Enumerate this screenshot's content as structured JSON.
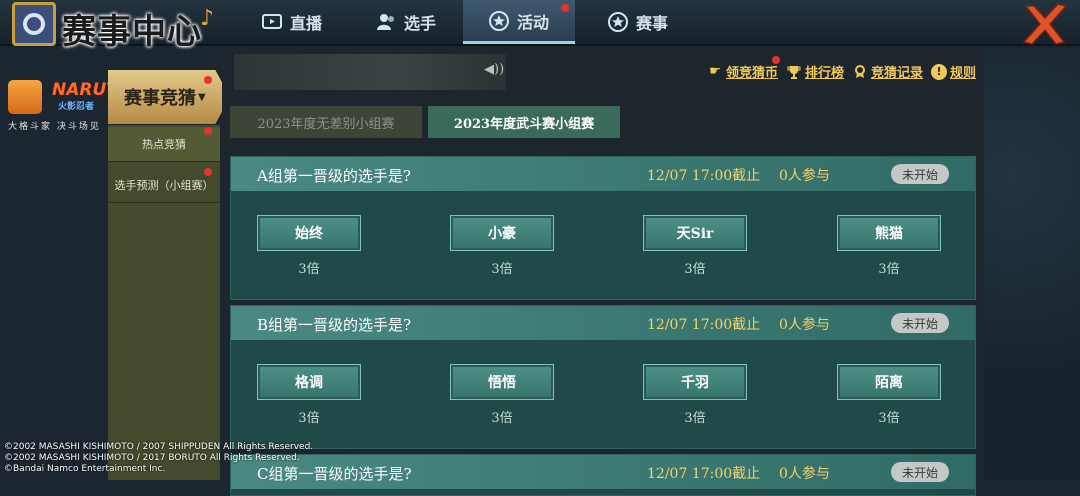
{
  "header": {
    "title": "赛事中心",
    "nav_tabs": [
      {
        "label": "直播",
        "icon": "tv-icon",
        "active": false,
        "dot": false
      },
      {
        "label": "选手",
        "icon": "user-icon",
        "active": false,
        "dot": false
      },
      {
        "label": "活动",
        "icon": "star-icon",
        "active": true,
        "dot": true
      },
      {
        "label": "赛事",
        "icon": "star-icon",
        "active": false,
        "dot": false
      }
    ]
  },
  "sidebar": {
    "brand": "NARUTO",
    "brand_sub": "火影忍者",
    "slogan": "大格斗家 决斗场见",
    "title": "赛事竞猜",
    "items": [
      {
        "label": "热点竞猜"
      },
      {
        "label": "选手预测（小组赛）"
      }
    ]
  },
  "toolbar": {
    "links": [
      {
        "label": "领竞猜币",
        "icon": "hand-icon"
      },
      {
        "label": "排行榜",
        "icon": "trophy-icon"
      },
      {
        "label": "竞猜记录",
        "icon": "medal-icon"
      },
      {
        "label": "规则",
        "icon": "info-icon"
      }
    ]
  },
  "subtabs": [
    {
      "label": "2023年度无差别小组赛",
      "active": false
    },
    {
      "label": "2023年度武斗赛小组赛",
      "active": true
    }
  ],
  "questions": [
    {
      "text": "A组第一晋级的选手是?",
      "deadline": "12/07  17:00截止",
      "participants": "0人参与",
      "status": "未开始",
      "options": [
        {
          "name": "始终",
          "odds": "3倍"
        },
        {
          "name": "小豪",
          "odds": "3倍"
        },
        {
          "name": "天Sir",
          "odds": "3倍"
        },
        {
          "name": "熊猫",
          "odds": "3倍"
        }
      ]
    },
    {
      "text": "B组第一晋级的选手是?",
      "deadline": "12/07  17:00截止",
      "participants": "0人参与",
      "status": "未开始",
      "options": [
        {
          "name": "格调",
          "odds": "3倍"
        },
        {
          "name": "悟悟",
          "odds": "3倍"
        },
        {
          "name": "千羽",
          "odds": "3倍"
        },
        {
          "name": "陌离",
          "odds": "3倍"
        }
      ]
    },
    {
      "text": "C组第一晋级的选手是?",
      "deadline": "12/07  17:00截止",
      "participants": "0人参与",
      "status": "未开始",
      "options": []
    }
  ],
  "copyright": [
    "©2002 MASASHI KISHIMOTO / 2007 SHIPPUDEN All Rights Reserved.",
    "©2002 MASASHI KISHIMOTO / 2017 BORUTO All Rights Reserved.",
    "©Bandai Namco Entertainment Inc."
  ],
  "colors": {
    "accent_gold": "#f0c95a",
    "active_tab": "#3a6b5a",
    "card_bg": "#1f4a47",
    "badge_dot": "#e8322d"
  }
}
